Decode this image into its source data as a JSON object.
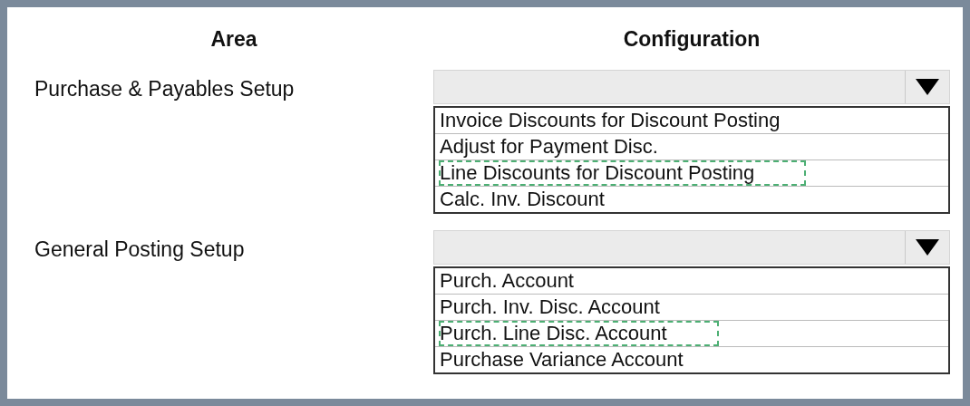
{
  "headers": {
    "area": "Area",
    "configuration": "Configuration"
  },
  "rows": [
    {
      "area": "Purchase & Payables Setup",
      "options": [
        {
          "label": "Invoice Discounts for Discount Posting",
          "selected": false
        },
        {
          "label": "Adjust for Payment Disc.",
          "selected": false
        },
        {
          "label": "Line Discounts for Discount Posting",
          "selected": true
        },
        {
          "label": "Calc. Inv. Discount",
          "selected": false
        }
      ]
    },
    {
      "area": "General Posting Setup",
      "options": [
        {
          "label": "Purch. Account",
          "selected": false
        },
        {
          "label": "Purch. Inv. Disc. Account",
          "selected": false
        },
        {
          "label": "Purch. Line Disc. Account",
          "selected": true
        },
        {
          "label": "Purchase Variance Account",
          "selected": false
        }
      ]
    }
  ]
}
